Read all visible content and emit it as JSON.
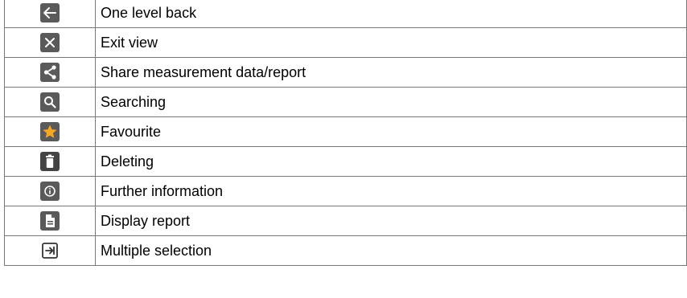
{
  "rows": [
    {
      "icon": "back-arrow-icon",
      "label": "One level back"
    },
    {
      "icon": "close-icon",
      "label": "Exit view"
    },
    {
      "icon": "share-icon",
      "label": "Share measurement data/report"
    },
    {
      "icon": "search-icon",
      "label": "Searching"
    },
    {
      "icon": "star-icon",
      "label": "Favourite"
    },
    {
      "icon": "trash-icon",
      "label": "Deleting"
    },
    {
      "icon": "info-icon",
      "label": "Further information"
    },
    {
      "icon": "document-icon",
      "label": "Display report"
    },
    {
      "icon": "multiple-selection-icon",
      "label": "Multiple selection"
    }
  ],
  "colors": {
    "icon_bg": "#5a5a5a",
    "star": "#f5a623",
    "border": "#777777"
  }
}
